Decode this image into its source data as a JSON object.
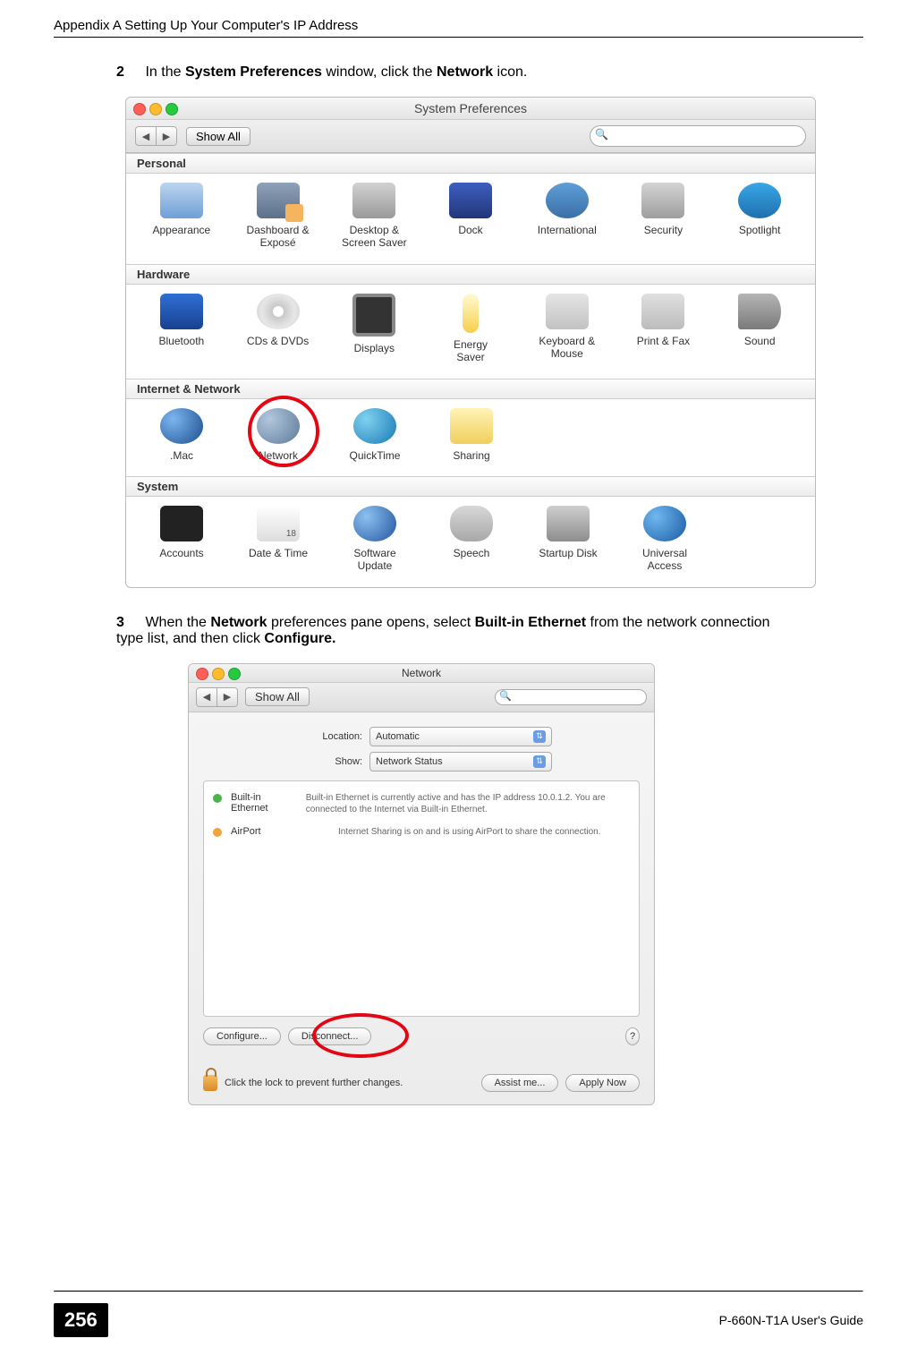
{
  "header": {
    "title": "Appendix A Setting Up Your Computer's IP Address"
  },
  "steps": {
    "s2": {
      "num": "2",
      "pre": "In the ",
      "b1": "System Preferences",
      "mid": " window, click the ",
      "b2": "Network",
      "post": " icon."
    },
    "s3": {
      "num": "3",
      "pre": "When the ",
      "b1": "Network",
      "mid": " preferences pane opens, select ",
      "b2": "Built-in Ethernet",
      "mid2": " from the network connection type list, and then click ",
      "b3": "Configure.",
      "post": ""
    }
  },
  "sysprefs": {
    "title": "System Preferences",
    "showall": "Show All",
    "search_placeholder": "",
    "sections": {
      "personal": "Personal",
      "hardware": "Hardware",
      "internet": "Internet & Network",
      "system": "System"
    },
    "items": {
      "appearance": "Appearance",
      "dashboard": "Dashboard &\nExposé",
      "desktop": "Desktop &\nScreen Saver",
      "dock": "Dock",
      "intl": "International",
      "security": "Security",
      "spotlight": "Spotlight",
      "bluetooth": "Bluetooth",
      "cds": "CDs & DVDs",
      "displays": "Displays",
      "energy": "Energy\nSaver",
      "keyboard": "Keyboard &\nMouse",
      "print": "Print & Fax",
      "sound": "Sound",
      "mac": ".Mac",
      "network": "Network",
      "quicktime": "QuickTime",
      "sharing": "Sharing",
      "accounts": "Accounts",
      "date": "Date & Time",
      "software": "Software\nUpdate",
      "speech": "Speech",
      "startup": "Startup Disk",
      "universal": "Universal\nAccess"
    }
  },
  "network": {
    "title": "Network",
    "showall": "Show All",
    "location_label": "Location:",
    "location_value": "Automatic",
    "show_label": "Show:",
    "show_value": "Network Status",
    "items": [
      {
        "name": "Built-in Ethernet",
        "desc": "Built-in Ethernet is currently active and has the IP address 10.0.1.2. You are connected to the Internet via Built-in Ethernet."
      },
      {
        "name": "AirPort",
        "desc": "Internet Sharing is on and is using AirPort to share the connection."
      }
    ],
    "configure": "Configure...",
    "disconnect": "Disconnect...",
    "help": "?",
    "lock_text": "Click the lock to prevent further changes.",
    "assist": "Assist me...",
    "apply": "Apply Now"
  },
  "footer": {
    "page": "256",
    "guide": "P-660N-T1A User's Guide"
  }
}
